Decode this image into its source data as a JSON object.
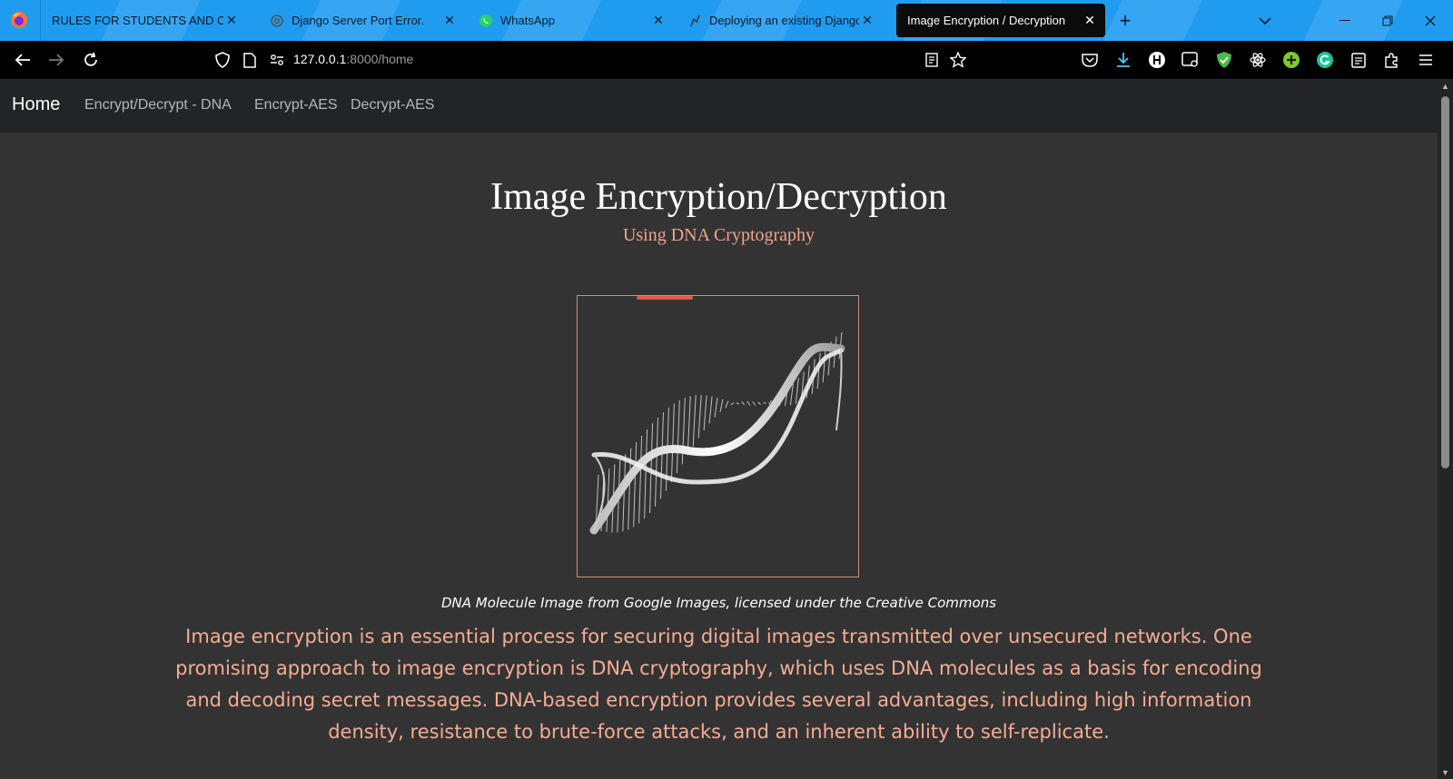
{
  "browser": {
    "tabs": [
      {
        "title": "RULES FOR STUDENTS AND CHILDREN",
        "icon": "document-icon",
        "active": false
      },
      {
        "title": "Django Server Port Error.",
        "icon": "openai-icon",
        "active": false
      },
      {
        "title": "WhatsApp",
        "icon": "whatsapp-icon",
        "active": false
      },
      {
        "title": "Deploying an existing Django project",
        "icon": "django-icon",
        "active": false
      },
      {
        "title": "Image Encryption / Decryption",
        "icon": "",
        "active": true
      }
    ],
    "url_host": "127.0.0.1",
    "url_rest": ":8000/home",
    "accent": "#1f9cf0"
  },
  "site": {
    "brand": "Home",
    "nav": [
      "Encrypt/Decrypt - DNA",
      "Encrypt-AES",
      "Decrypt-AES"
    ]
  },
  "hero": {
    "title": "Image Encryption/Decryption",
    "subtitle": "Using DNA Cryptography"
  },
  "figure": {
    "image_name": "dna-helix-image",
    "caption": "DNA Molecule Image from Google Images, licensed under the Creative Commons"
  },
  "description": "Image encryption is an essential process for securing digital images transmitted over unsecured networks. One promising approach to image encryption is DNA cryptography, which uses DNA molecules as a basis for encoding and decoding secret messages. DNA-based encryption provides several advantages, including high information density, resistance to brute-force attacks, and an inherent ability to self-replicate."
}
